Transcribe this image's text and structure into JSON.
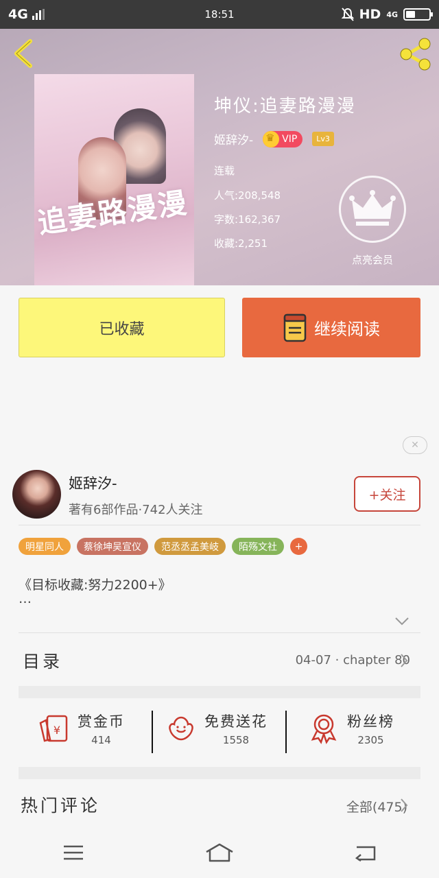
{
  "status_bar": {
    "network": "4G",
    "time": "18:51",
    "hd": "HD",
    "net2": "4G"
  },
  "book": {
    "cover_title": "追妻路漫漫",
    "title": "坤仪:追妻路漫漫",
    "author": "姬辞汐-",
    "vip_label": "VIP",
    "level": "Lv3",
    "status": "连载",
    "popularity": "人气:208,548",
    "words": "字数:162,367",
    "favorites": "收藏:2,251",
    "member_label": "点亮会员"
  },
  "actions": {
    "collected": "已收藏",
    "continue": "继续阅读"
  },
  "author_section": {
    "name": "姬辞汐-",
    "meta": "著有6部作品·742人关注",
    "follow": "+关注",
    "tags": [
      {
        "label": "明星同人",
        "color": "#f0a23c"
      },
      {
        "label": "蔡徐坤吴宣仪",
        "color": "#c87362"
      },
      {
        "label": "范丞丞孟美岐",
        "color": "#d09a3e"
      },
      {
        "label": "陌殇文社",
        "color": "#86b45a"
      }
    ],
    "tag_add": "+",
    "description": "《目标收藏:努力2200+》",
    "description_more": "…"
  },
  "toc": {
    "label": "目录",
    "latest": "04-07 · chapter 80"
  },
  "stats": [
    {
      "label": "赏金币",
      "value": "414"
    },
    {
      "label": "免费送花",
      "value": "1558"
    },
    {
      "label": "粉丝榜",
      "value": "2305"
    }
  ],
  "comments": {
    "label": "热门评论",
    "all": "全部(475)"
  },
  "colors": {
    "accent": "#e8693f",
    "collected_bg": "#fdf77a",
    "follow": "#c6453a"
  }
}
